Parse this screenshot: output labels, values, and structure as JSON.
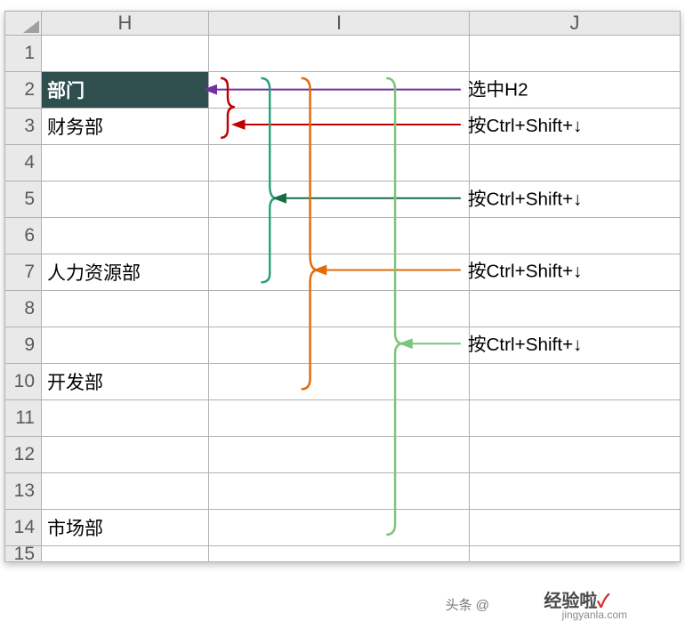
{
  "columns": [
    "H",
    "I",
    "J"
  ],
  "rows": [
    "1",
    "2",
    "3",
    "4",
    "5",
    "6",
    "7",
    "8",
    "9",
    "10",
    "11",
    "12",
    "13",
    "14",
    "15"
  ],
  "cells": {
    "h2": "部门",
    "h3": "财务部",
    "h7": "人力资源部",
    "h10": "开发部",
    "h14": "市场部"
  },
  "annotations": {
    "a1": "选中H2",
    "a2": "按Ctrl+Shift+↓",
    "a3": "按Ctrl+Shift+↓",
    "a4": "按Ctrl+Shift+↓",
    "a5": "按Ctrl+Shift+↓"
  },
  "watermark": {
    "w1": "头条 @",
    "w2": "经验啦",
    "check": "✓",
    "w3": "jingyanla.com"
  },
  "colors": {
    "purple": "#7030a0",
    "red": "#c00000",
    "teal": "#2aa17e",
    "darkgreen": "#1b6b47",
    "orange": "#e26b0a",
    "lightgreen": "#7dc47d"
  }
}
